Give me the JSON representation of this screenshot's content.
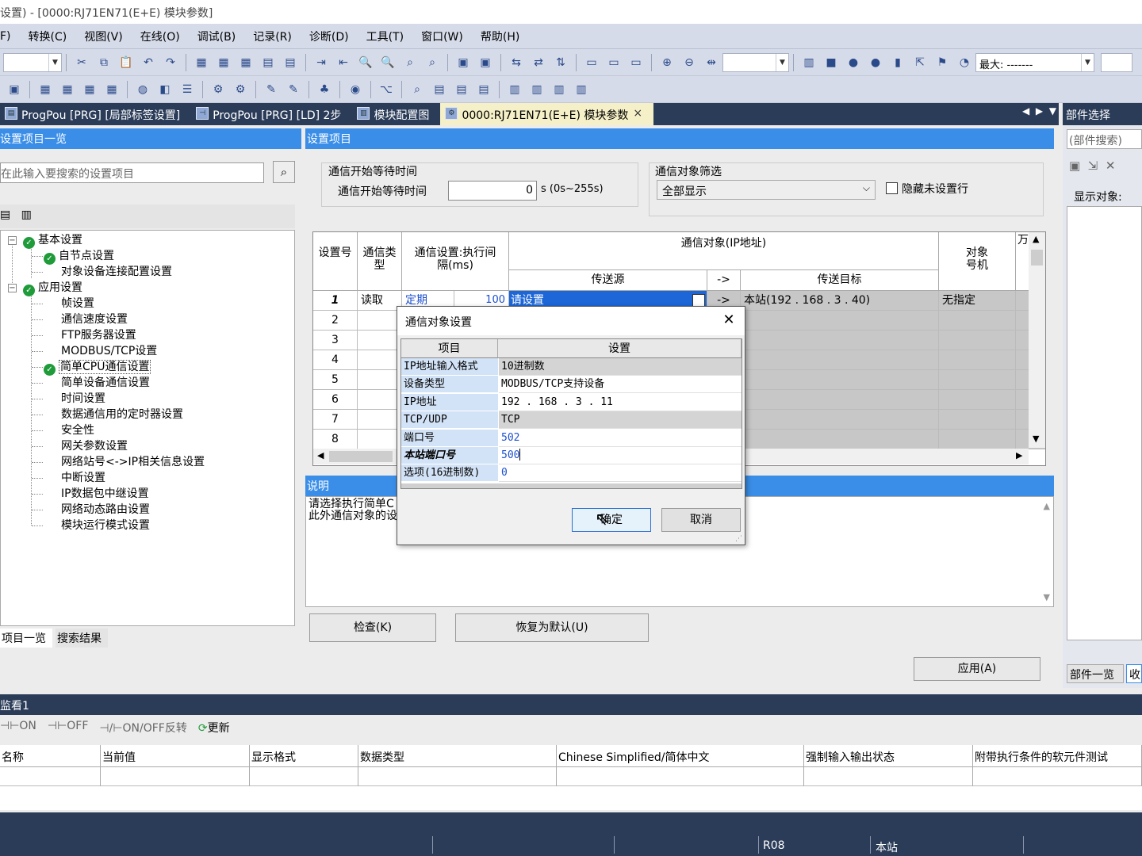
{
  "window": {
    "title": "设置) - [0000:RJ71EN71(E+E) 模块参数]"
  },
  "menu": [
    "F)",
    "转换(C)",
    "视图(V)",
    "在线(O)",
    "调试(B)",
    "记录(R)",
    "诊断(D)",
    "工具(T)",
    "窗口(W)",
    "帮助(H)"
  ],
  "toolbar": {
    "zoom_label": "最大:",
    "zoom_value": "-------"
  },
  "tabs": [
    {
      "label": "ProgPou [PRG] [局部标签设置]"
    },
    {
      "label": "ProgPou [PRG] [LD] 2步"
    },
    {
      "label": "模块配置图"
    },
    {
      "label": "0000:RJ71EN71(E+E) 模块参数",
      "close": "×"
    }
  ],
  "left_panel": {
    "title": "设置项目一览",
    "search_placeholder": "在此输入要搜索的设置项目",
    "tree": [
      {
        "label": "基本设置",
        "level": 0,
        "check": true
      },
      {
        "label": "自节点设置",
        "level": 1,
        "check": true
      },
      {
        "label": "对象设备连接配置设置",
        "level": 1,
        "check": false
      },
      {
        "label": "应用设置",
        "level": 0,
        "check": true
      },
      {
        "label": "帧设置",
        "level": 1,
        "check": false
      },
      {
        "label": "通信速度设置",
        "level": 1,
        "check": false
      },
      {
        "label": "FTP服务器设置",
        "level": 1,
        "check": false
      },
      {
        "label": "MODBUS/TCP设置",
        "level": 1,
        "check": false
      },
      {
        "label": "简单CPU通信设置",
        "level": 1,
        "check": true,
        "selected": true
      },
      {
        "label": "简单设备通信设置",
        "level": 1,
        "check": false
      },
      {
        "label": "时间设置",
        "level": 1,
        "check": false
      },
      {
        "label": "数据通信用的定时器设置",
        "level": 1,
        "check": false
      },
      {
        "label": "安全性",
        "level": 1,
        "check": false
      },
      {
        "label": "网关参数设置",
        "level": 1,
        "check": false
      },
      {
        "label": "网络站号<->IP相关信息设置",
        "level": 1,
        "check": false
      },
      {
        "label": "中断设置",
        "level": 1,
        "check": false
      },
      {
        "label": "IP数据包中继设置",
        "level": 1,
        "check": false
      },
      {
        "label": "网络动态路由设置",
        "level": 1,
        "check": false
      },
      {
        "label": "模块运行模式设置",
        "level": 1,
        "check": false
      }
    ],
    "bottom_tabs": [
      "项目一览",
      "搜索结果"
    ]
  },
  "main": {
    "title": "设置项目",
    "group1_title": "通信开始等待时间",
    "wait_label": "通信开始等待时间",
    "wait_value": "0",
    "wait_unit": "s (0s~255s)",
    "group2_title": "通信对象筛选",
    "filter_value": "全部显示",
    "hide_label": "隐藏未设置行",
    "grid": {
      "h_no": "设置号",
      "h_type": "通信类型",
      "h_interval": "通信设置:执行间隔(ms)",
      "h_target": "通信对象(IP地址)",
      "h_src": "传送源",
      "h_arrow": "->",
      "h_dst": "传送目标",
      "h_station": "对象号机",
      "h_extra": "万",
      "rows": [
        {
          "no": "1",
          "type": "读取",
          "mode": "定期",
          "interval": "100",
          "src": "请设置",
          "arrow": "->",
          "dst": "本站(192 . 168 .   3 .  40)",
          "station": "无指定"
        },
        {
          "no": "2"
        },
        {
          "no": "3"
        },
        {
          "no": "4"
        },
        {
          "no": "5"
        },
        {
          "no": "6"
        },
        {
          "no": "7"
        },
        {
          "no": "8"
        }
      ]
    },
    "desc_title": "说明",
    "desc_line1": "请选择执行简单C",
    "desc_line2": "此外通信对象的设",
    "check_button": "检查(K)",
    "default_button": "恢复为默认(U)",
    "apply_button": "应用(A)"
  },
  "right_panel": {
    "title": "部件选择",
    "search_placeholder": "(部件搜索)",
    "display_label": "显示对象:",
    "bottom_tab1": "部件一览",
    "bottom_tab2": "收"
  },
  "watch": {
    "title": "监看1",
    "tb_on": "ON",
    "tb_off": "OFF",
    "tb_toggle": "ON/OFF反转",
    "tb_refresh": "更新",
    "columns": [
      "名称",
      "当前值",
      "显示格式",
      "数据类型",
      "Chinese Simplified/简体中文",
      "强制输入输出状态",
      "附带执行条件的软元件测试"
    ]
  },
  "status": {
    "cpu": "R08",
    "station": "本站"
  },
  "dialog": {
    "title": "通信对象设置",
    "h_item": "项目",
    "h_setting": "设置",
    "rows": [
      {
        "k": "IP地址输入格式",
        "v": "10进制数"
      },
      {
        "k": "设备类型",
        "v": "MODBUS/TCP支持设备"
      },
      {
        "k": "IP地址",
        "v": "192 . 168 .   3 .  11"
      },
      {
        "k": "TCP/UDP",
        "v": "TCP"
      },
      {
        "k": "端口号",
        "v": "502"
      },
      {
        "k": "本站端口号",
        "v": "500"
      },
      {
        "k": "选项(16进制数)",
        "v": "0"
      }
    ],
    "ok": "确定",
    "cancel": "取消"
  }
}
